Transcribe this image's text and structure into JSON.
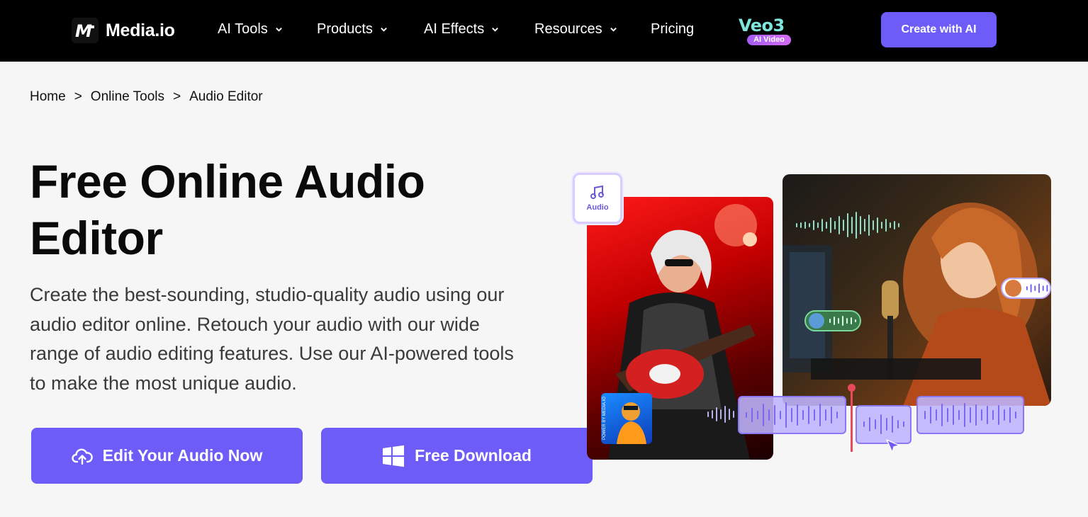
{
  "nav": {
    "logo_text": "Media.io",
    "logo_mark": "M",
    "items": [
      {
        "label": "AI Tools",
        "has_dropdown": true
      },
      {
        "label": "Products",
        "has_dropdown": true
      },
      {
        "label": "AI Effects",
        "has_dropdown": true
      },
      {
        "label": "Resources",
        "has_dropdown": true
      },
      {
        "label": "Pricing",
        "has_dropdown": false
      }
    ],
    "veo_title": "Veo3",
    "veo_badge": "AI Video",
    "cta_label": "Create with AI"
  },
  "breadcrumb": {
    "items": [
      "Home",
      "Online Tools",
      "Audio Editor"
    ],
    "separator": ">"
  },
  "hero": {
    "title_line1": "Free Online Audio",
    "title_line2": "Editor",
    "description": "Create the best-sounding, studio-quality audio using our audio editor online. Retouch your audio with our wide range of audio editing features. Use our AI-powered tools to make the most unique audio.",
    "primary_button": "Edit Your Audio Now",
    "secondary_button": "Free Download",
    "audio_chip_label": "Audio",
    "thumb_caption": "POWER BY MEDIA.IO"
  },
  "colors": {
    "nav_bg": "#000000",
    "accent": "#6e5cf8",
    "page_bg": "#f6f6f7"
  },
  "icons": [
    "chevron-down-icon",
    "cloud-upload-icon",
    "windows-icon",
    "music-note-icon",
    "waveform-icon",
    "cursor-icon"
  ]
}
